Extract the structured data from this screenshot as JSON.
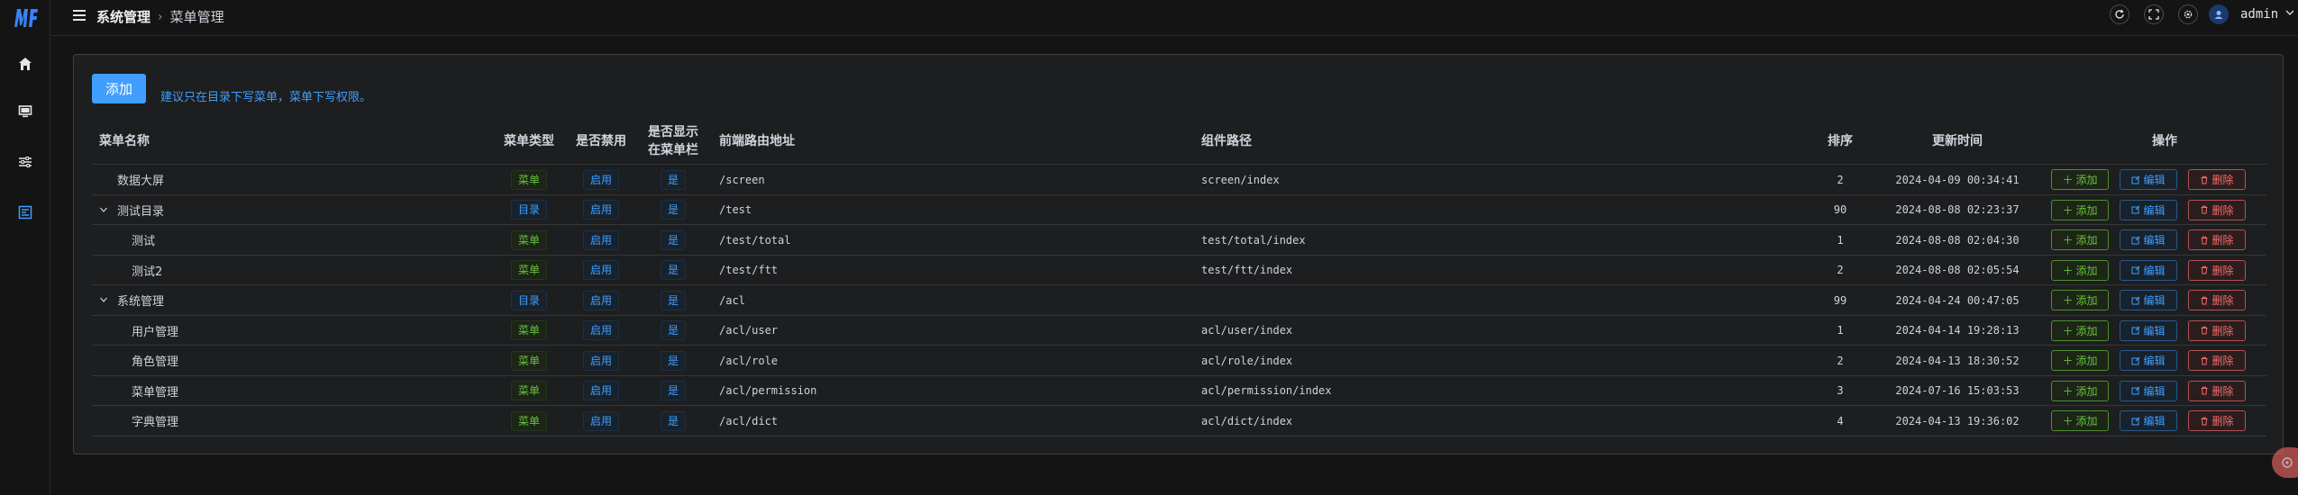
{
  "app": {
    "logo_text": "MF",
    "nav": [
      {
        "name": "home-icon"
      },
      {
        "name": "monitor-icon"
      },
      {
        "name": "sliders-icon"
      },
      {
        "name": "dashboard-icon"
      }
    ]
  },
  "header": {
    "breadcrumb": [
      "系统管理",
      "菜单管理"
    ],
    "user": "admin"
  },
  "toolbar": {
    "add_label": "添加",
    "hint": "建议只在目录下写菜单，菜单下写权限。"
  },
  "table": {
    "headers": {
      "name": "菜单名称",
      "type": "菜单类型",
      "disabled": "是否禁用",
      "show_line1": "是否显示",
      "show_line2": "在菜单栏",
      "route": "前端路由地址",
      "component": "组件路径",
      "sort": "排序",
      "updated": "更新时间",
      "actions": "操作"
    },
    "rows": [
      {
        "name": "数据大屏",
        "level": 0,
        "expandable": false,
        "type": "菜单",
        "disabled": "启用",
        "show": "是",
        "route": "/screen",
        "component": "screen/index",
        "sort": "2",
        "updated": "2024-04-09 00:34:41"
      },
      {
        "name": "测试目录",
        "level": 0,
        "expandable": true,
        "type": "目录",
        "disabled": "启用",
        "show": "是",
        "route": "/test",
        "component": "",
        "sort": "90",
        "updated": "2024-08-08 02:23:37"
      },
      {
        "name": "测试",
        "level": 1,
        "expandable": false,
        "type": "菜单",
        "disabled": "启用",
        "show": "是",
        "route": "/test/total",
        "component": "test/total/index",
        "sort": "1",
        "updated": "2024-08-08 02:04:30"
      },
      {
        "name": "测试2",
        "level": 1,
        "expandable": false,
        "type": "菜单",
        "disabled": "启用",
        "show": "是",
        "route": "/test/ftt",
        "component": "test/ftt/index",
        "sort": "2",
        "updated": "2024-08-08 02:05:54"
      },
      {
        "name": "系统管理",
        "level": 0,
        "expandable": true,
        "type": "目录",
        "disabled": "启用",
        "show": "是",
        "route": "/acl",
        "component": "",
        "sort": "99",
        "updated": "2024-04-24 00:47:05"
      },
      {
        "name": "用户管理",
        "level": 1,
        "expandable": false,
        "type": "菜单",
        "disabled": "启用",
        "show": "是",
        "route": "/acl/user",
        "component": "acl/user/index",
        "sort": "1",
        "updated": "2024-04-14 19:28:13"
      },
      {
        "name": "角色管理",
        "level": 1,
        "expandable": false,
        "type": "菜单",
        "disabled": "启用",
        "show": "是",
        "route": "/acl/role",
        "component": "acl/role/index",
        "sort": "2",
        "updated": "2024-04-13 18:30:52"
      },
      {
        "name": "菜单管理",
        "level": 1,
        "expandable": false,
        "type": "菜单",
        "disabled": "启用",
        "show": "是",
        "route": "/acl/permission",
        "component": "acl/permission/index",
        "sort": "3",
        "updated": "2024-07-16 15:03:53"
      },
      {
        "name": "字典管理",
        "level": 1,
        "expandable": false,
        "type": "菜单",
        "disabled": "启用",
        "show": "是",
        "route": "/acl/dict",
        "component": "acl/dict/index",
        "sort": "4",
        "updated": "2024-04-13 19:36:02"
      }
    ],
    "actions": {
      "add": "添加",
      "edit": "编辑",
      "delete": "删除"
    }
  },
  "colors": {
    "primary": "#409eff",
    "success": "#67c23a",
    "danger": "#f56c6c",
    "background": "#141414"
  }
}
